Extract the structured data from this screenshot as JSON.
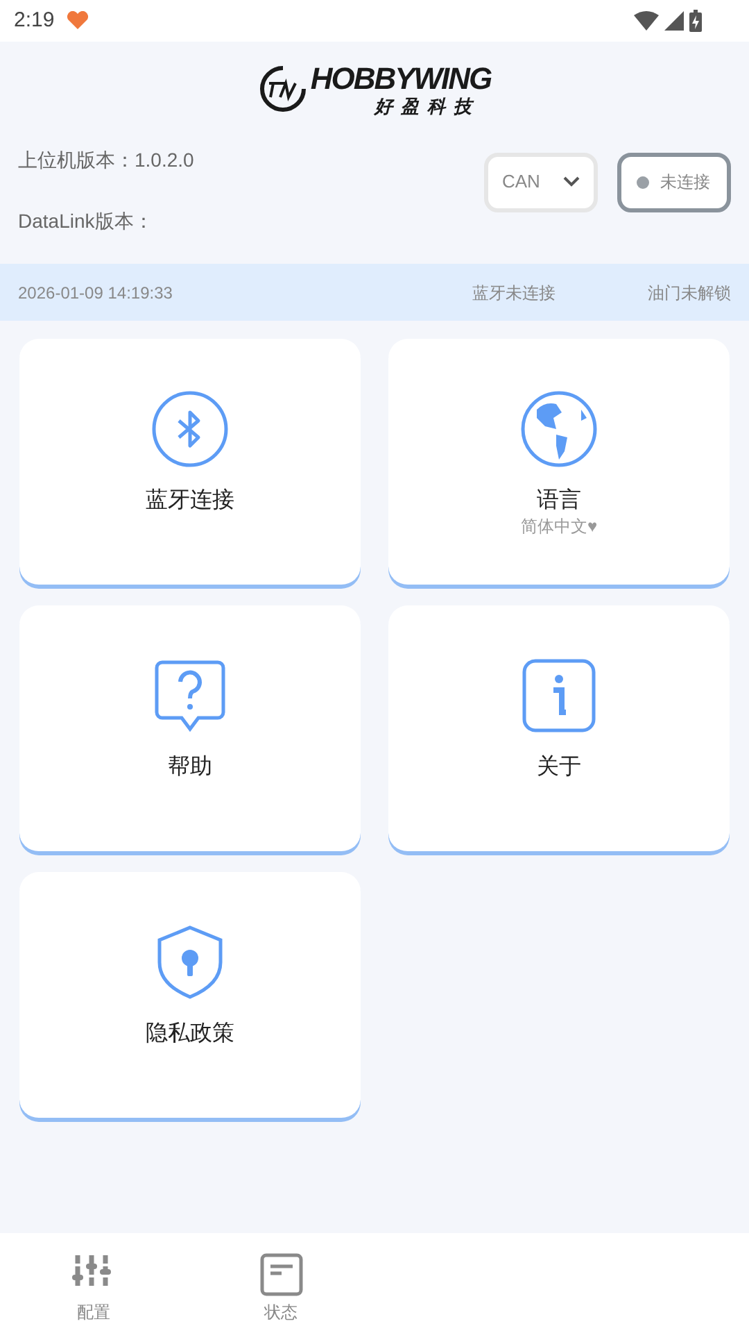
{
  "status_bar": {
    "time": "2:19"
  },
  "logo": {
    "brand": "HOBBYWING",
    "subtitle": "好盈科技"
  },
  "versions": [
    {
      "label": "上位机版本：1.0.2.0"
    },
    {
      "label": "DataLink版本："
    }
  ],
  "protocol_select": {
    "value": "CAN"
  },
  "connection": {
    "label": "未连接",
    "connected": false
  },
  "info_bar": {
    "datetime": "2026-01-09 14:19:33",
    "bluetooth": "蓝牙未连接",
    "throttle": "油门未解锁"
  },
  "cards": [
    {
      "kind": "bluetooth",
      "title": "蓝牙连接"
    },
    {
      "kind": "language",
      "title": "语言",
      "subtitle": "简体中文♥"
    },
    {
      "kind": "help",
      "title": "帮助"
    },
    {
      "kind": "about",
      "title": "关于"
    },
    {
      "kind": "privacy",
      "title": "隐私政策"
    }
  ],
  "bottom_nav": [
    {
      "kind": "config",
      "label": "配置"
    },
    {
      "kind": "status",
      "label": "状态"
    }
  ]
}
